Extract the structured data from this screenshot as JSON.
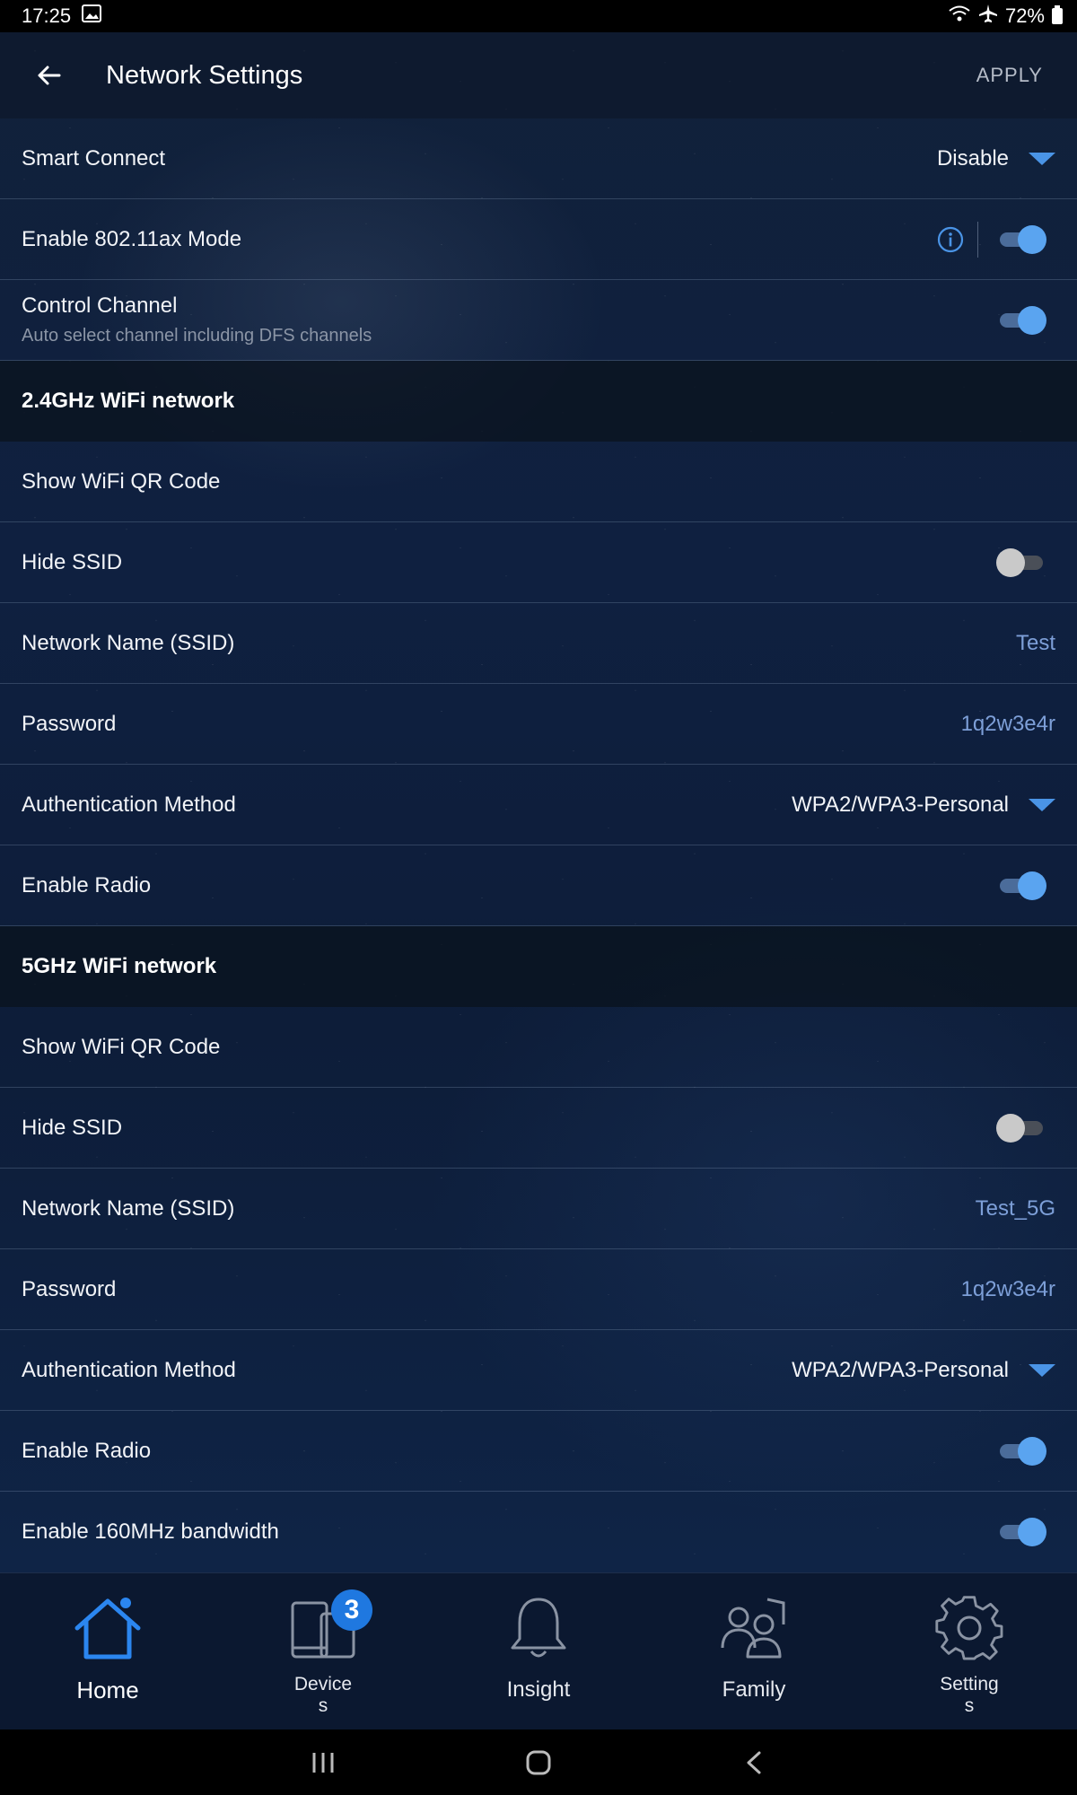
{
  "status_bar": {
    "time": "17:25",
    "battery": "72%"
  },
  "header": {
    "title": "Network Settings",
    "apply_label": "APPLY"
  },
  "rows": {
    "smart_connect": {
      "label": "Smart Connect",
      "value": "Disable"
    },
    "ax_mode": {
      "label": "Enable 802.11ax Mode",
      "enabled": true
    },
    "control_channel": {
      "label": "Control Channel",
      "sub": "Auto select channel including DFS channels",
      "enabled": true
    }
  },
  "wifi_24": {
    "title": "2.4GHz WiFi network",
    "qr_label": "Show WiFi QR Code",
    "hide_ssid_label": "Hide SSID",
    "hide_ssid": false,
    "ssid_label": "Network Name (SSID)",
    "ssid": "Test",
    "password_label": "Password",
    "password": "1q2w3e4r",
    "auth_label": "Authentication Method",
    "auth": "WPA2/WPA3-Personal",
    "radio_label": "Enable Radio",
    "radio": true
  },
  "wifi_5": {
    "title": "5GHz WiFi network",
    "qr_label": "Show WiFi QR Code",
    "hide_ssid_label": "Hide SSID",
    "hide_ssid": false,
    "ssid_label": "Network Name (SSID)",
    "ssid": "Test_5G",
    "password_label": "Password",
    "password": "1q2w3e4r",
    "auth_label": "Authentication Method",
    "auth": "WPA2/WPA3-Personal",
    "radio_label": "Enable Radio",
    "radio": true,
    "bw160_label": "Enable 160MHz bandwidth",
    "bw160": true
  },
  "bottom_nav": {
    "home": "Home",
    "devices_line1": "Device",
    "devices_line2": "s",
    "devices_badge": "3",
    "insight": "Insight",
    "family": "Family",
    "settings_line1": "Setting",
    "settings_line2": "s"
  },
  "colors": {
    "accent": "#5aa4f0",
    "caret": "#4a94e6",
    "value_text": "#7d9fd8",
    "badge": "#1f78e0"
  }
}
